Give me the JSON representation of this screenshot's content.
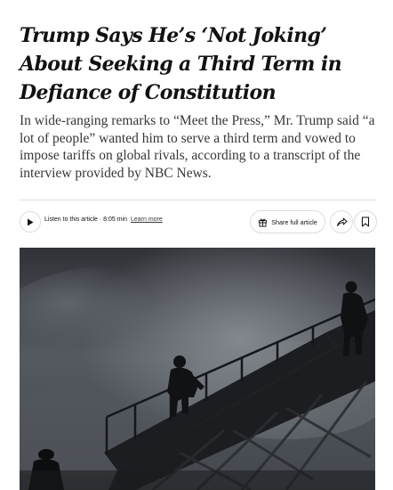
{
  "article": {
    "headline": "Trump Says He’s ‘Not Joking’ About Seeking a Third Term in Defiance of Constitution",
    "summary": "In wide-ranging remarks to “Meet the Press,” Mr. Trump said “a lot of people” wanted him to serve a third term and vowed to impose tariffs on global rivals, according to a transcript of the interview provided by NBC News."
  },
  "toolbar": {
    "play_icon": "play-icon",
    "listen_text": "Listen to this article · 8:05 min",
    "learn_more": "Learn more",
    "share_label": "Share full article",
    "share_icon": "gift-icon",
    "forward_icon": "share-arrow-icon",
    "bookmark_icon": "bookmark-icon"
  },
  "photo": {
    "subject": "Figures descending an airplane staircase silhouetted against a cloudy sky"
  }
}
